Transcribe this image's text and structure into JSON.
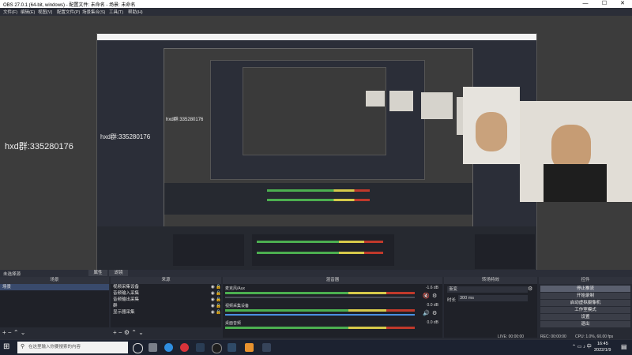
{
  "window": {
    "title": "OBS 27.0.1 (64-bit, windows) - 配置文件: 未命名 - 场景: 未命名",
    "minimize": "—",
    "maximize": "☐",
    "close": "✕"
  },
  "menu": [
    "文件(F)",
    "编辑(E)",
    "视图(V)",
    "配置文件(P)",
    "场景集合(S)",
    "工具(T)",
    "帮助(H)"
  ],
  "watermark": {
    "large": "hxd群:335280176",
    "medium": "hxd群:335280176",
    "small": "hxd群:335280176"
  },
  "status_strip": {
    "no_source": "未选择源",
    "properties": "属性",
    "filters": "滤镜"
  },
  "scenes": {
    "header": "场景",
    "items": [
      "场景"
    ]
  },
  "sources": {
    "header": "来源",
    "items": [
      "视频采集设备",
      "音频输入采集",
      "音频输出采集",
      "群",
      "显示器采集"
    ]
  },
  "mixer": {
    "header": "混音器",
    "channels": [
      {
        "name": "麦克风/Aux",
        "db": "-1.6 dB"
      },
      {
        "name": "视频采集设备",
        "db": "0.0 dB"
      },
      {
        "name": "桌面音频",
        "db": "0.0 dB"
      }
    ]
  },
  "transitions": {
    "header": "转场特效",
    "type": "渐变",
    "duration_label": "时长",
    "duration_value": "300 ms"
  },
  "controls": {
    "header": "控件",
    "buttons": [
      "停止推流",
      "开始录制",
      "启动虚拟摄像机",
      "工作室模式",
      "设置",
      "退出"
    ]
  },
  "status": {
    "live": "LIVE: 00:00:00",
    "rec": "REC: 00:00:00",
    "cpu": "CPU: 1.0%, 60.00 fps"
  },
  "taskbar": {
    "search_placeholder": "在这里输入你要搜索的内容",
    "time": "16:45",
    "date": "2022/1/9"
  },
  "colors": {
    "accent": "#4a90e2",
    "meter_green": "#4caf50",
    "meter_yellow": "#d6c94a",
    "meter_red": "#c0392b"
  }
}
